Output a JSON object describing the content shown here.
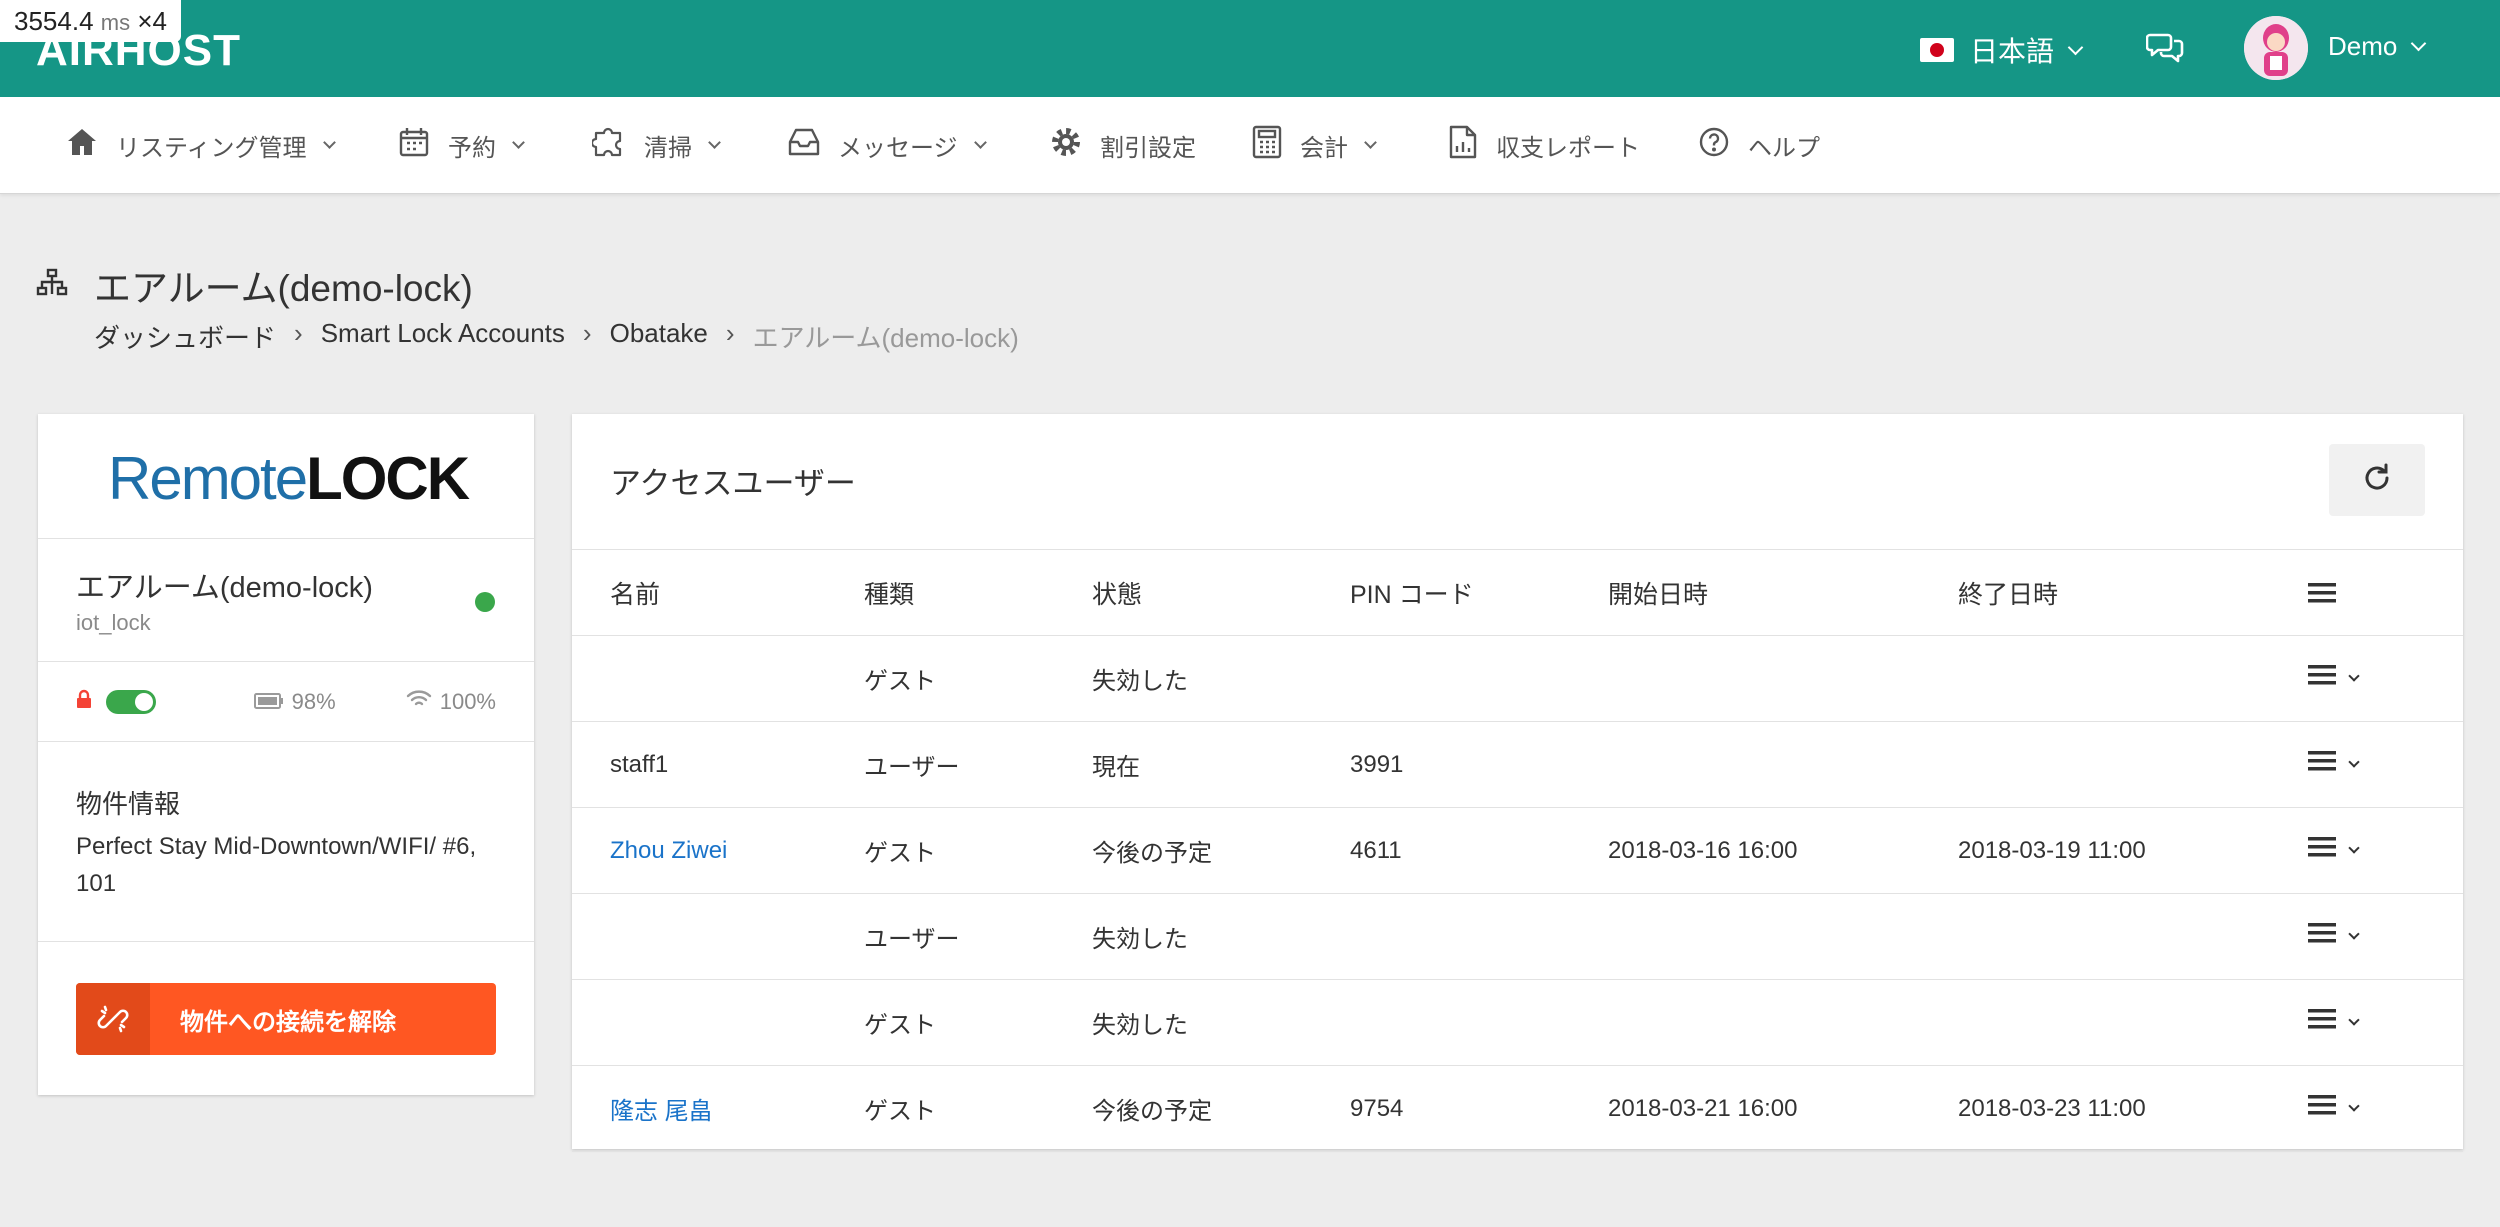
{
  "perf": {
    "value": "3554.4",
    "unit": "ms",
    "mult": "×4"
  },
  "header": {
    "logo": "AIRHOST",
    "language": "日本語",
    "user": "Demo"
  },
  "nav": [
    {
      "label": "リスティング管理"
    },
    {
      "label": "予約"
    },
    {
      "label": "清掃"
    },
    {
      "label": "メッセージ"
    },
    {
      "label": "割引設定"
    },
    {
      "label": "会計"
    },
    {
      "label": "収支レポート"
    },
    {
      "label": "ヘルプ"
    }
  ],
  "page": {
    "title": "エアルーム(demo-lock)",
    "breadcrumb": [
      "ダッシュボード",
      "Smart Lock Accounts",
      "Obatake",
      "エアルーム(demo-lock)"
    ],
    "breadcrumb_sep": "›"
  },
  "lock": {
    "brand_remote": "Remote",
    "brand_lock": "LOCK",
    "name": "エアルーム(demo-lock)",
    "type": "iot_lock",
    "status_color": "#3aa74b",
    "battery": "98%",
    "wifi": "100%",
    "property_label": "物件情報",
    "property_value": "Perfect Stay Mid-Downtown/WIFI/ #6, 101",
    "disconnect_label": "物件への接続を解除"
  },
  "access": {
    "title": "アクセスユーザー",
    "columns": [
      "名前",
      "種類",
      "状態",
      "PIN コード",
      "開始日時",
      "終了日時"
    ],
    "rows": [
      {
        "name": "",
        "type": "ゲスト",
        "status": "失効した",
        "pin": "",
        "start": "",
        "end": ""
      },
      {
        "name": "staff1",
        "type": "ユーザー",
        "status": "現在",
        "pin": "3991",
        "start": "",
        "end": ""
      },
      {
        "name": "Zhou Ziwei",
        "type": "ゲスト",
        "status": "今後の予定",
        "pin": "4611",
        "start": "2018-03-16 16:00",
        "end": "2018-03-19 11:00"
      },
      {
        "name": "",
        "type": "ユーザー",
        "status": "失効した",
        "pin": "",
        "start": "",
        "end": ""
      },
      {
        "name": "",
        "type": "ゲスト",
        "status": "失効した",
        "pin": "",
        "start": "",
        "end": ""
      },
      {
        "name": "隆志 尾畠",
        "type": "ゲスト",
        "status": "今後の予定",
        "pin": "9754",
        "start": "2018-03-21 16:00",
        "end": "2018-03-23 11:00"
      }
    ]
  },
  "colors": {
    "brand_teal": "#159686",
    "accent_orange": "#ff5722",
    "link_blue": "#1a73c9"
  }
}
